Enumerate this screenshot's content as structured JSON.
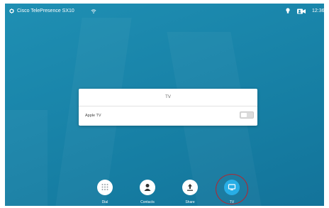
{
  "topbar": {
    "device_name": "Cisco TelePresence SX10",
    "time": "12:36",
    "icons": [
      "gear-icon",
      "wifi-icon",
      "lightbulb-icon",
      "camera-self-view-icon"
    ]
  },
  "dialog": {
    "title": "TV",
    "option_label": "Apple TV",
    "toggle_on": false
  },
  "bottom_bar": {
    "buttons": [
      {
        "label": "Dial",
        "icon": "dialpad-icon",
        "active": false
      },
      {
        "label": "Contacts",
        "icon": "person-icon",
        "active": false
      },
      {
        "label": "Share",
        "icon": "share-upload-icon",
        "active": false
      },
      {
        "label": "TV",
        "icon": "tv-monitor-icon",
        "active": true
      }
    ]
  },
  "colors": {
    "background": "#1a86ab",
    "active_button": "#28aee6",
    "highlight_ring": "#b3262f"
  }
}
